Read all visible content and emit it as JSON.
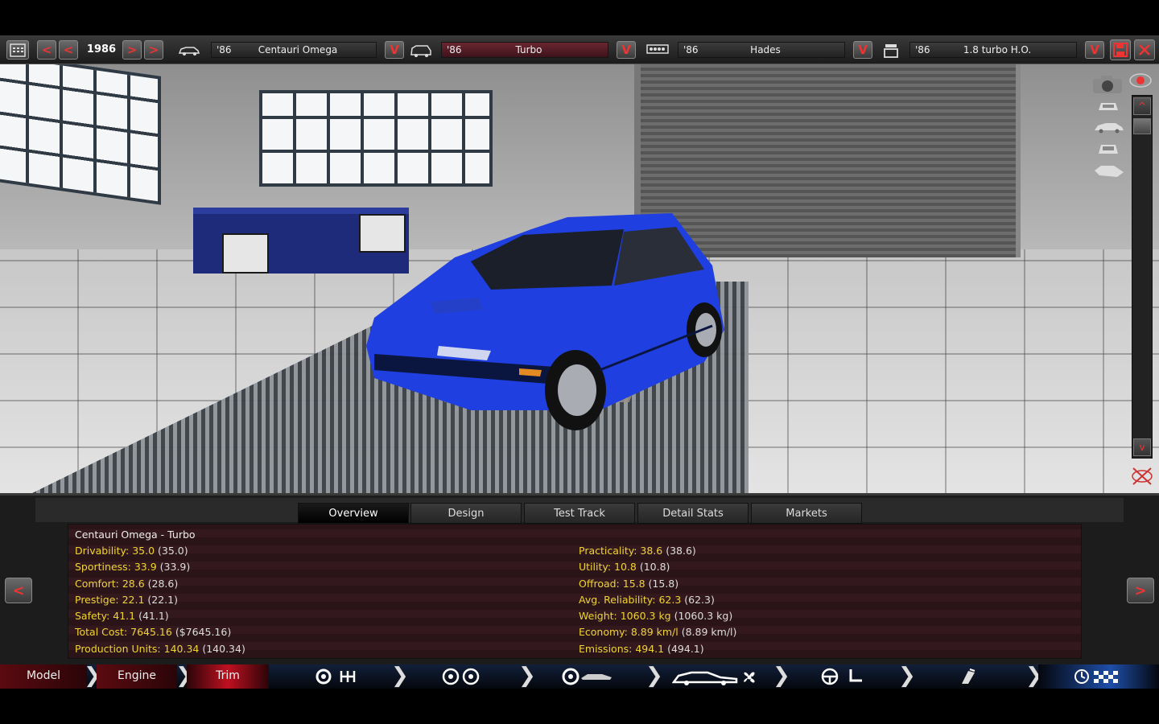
{
  "topbar": {
    "year": "1986",
    "year_prev2": "<",
    "year_prev": "<",
    "year_next": ">",
    "year_next2": ">",
    "model": {
      "year": "'86",
      "name": "Centauri Omega"
    },
    "trim": {
      "year": "'86",
      "name": "Turbo"
    },
    "engine_family": {
      "year": "'86",
      "name": "Hades"
    },
    "engine": {
      "year": "'86",
      "name": "1.8 turbo H.O."
    },
    "dropdown_glyph": "V"
  },
  "viewport": {
    "scroll_up": "^",
    "scroll_down": "v"
  },
  "tabs": [
    {
      "label": "Overview",
      "active": true
    },
    {
      "label": "Design",
      "active": false
    },
    {
      "label": "Test Track",
      "active": false
    },
    {
      "label": "Detail Stats",
      "active": false
    },
    {
      "label": "Markets",
      "active": false
    }
  ],
  "overview": {
    "title": "Centauri Omega - Turbo",
    "left": [
      {
        "key": "Drivability: 35.0",
        "val": " (35.0)"
      },
      {
        "key": "Sportiness: 33.9",
        "val": " (33.9)"
      },
      {
        "key": "Comfort: 28.6",
        "val": " (28.6)"
      },
      {
        "key": "Prestige: 22.1",
        "val": " (22.1)"
      },
      {
        "key": "Safety: 41.1",
        "val": " (41.1)"
      },
      {
        "key": "Total Cost: 7645.16",
        "val": " ($7645.16)"
      },
      {
        "key": "Production Units: 140.34",
        "val": " (140.34)"
      }
    ],
    "right": [
      {
        "key": "Practicality: 38.6",
        "val": " (38.6)"
      },
      {
        "key": "Utility: 10.8",
        "val": " (10.8)"
      },
      {
        "key": "Offroad: 15.8",
        "val": " (15.8)"
      },
      {
        "key": "Avg. Reliability: 62.3",
        "val": " (62.3)"
      },
      {
        "key": "Weight: 1060.3 kg",
        "val": " (1060.3 kg)"
      },
      {
        "key": "Economy: 8.89 km/l",
        "val": " (8.89 km/l)"
      },
      {
        "key": "Emissions: 494.1",
        "val": " (494.1)"
      }
    ],
    "prev": "<",
    "next": ">"
  },
  "nav": {
    "model": "Model",
    "engine": "Engine",
    "trim": "Trim",
    "chevron": "❯"
  },
  "colors": {
    "car": "#1f3fe0",
    "stat_key": "#f0d432",
    "accent_red": "#e33333"
  }
}
